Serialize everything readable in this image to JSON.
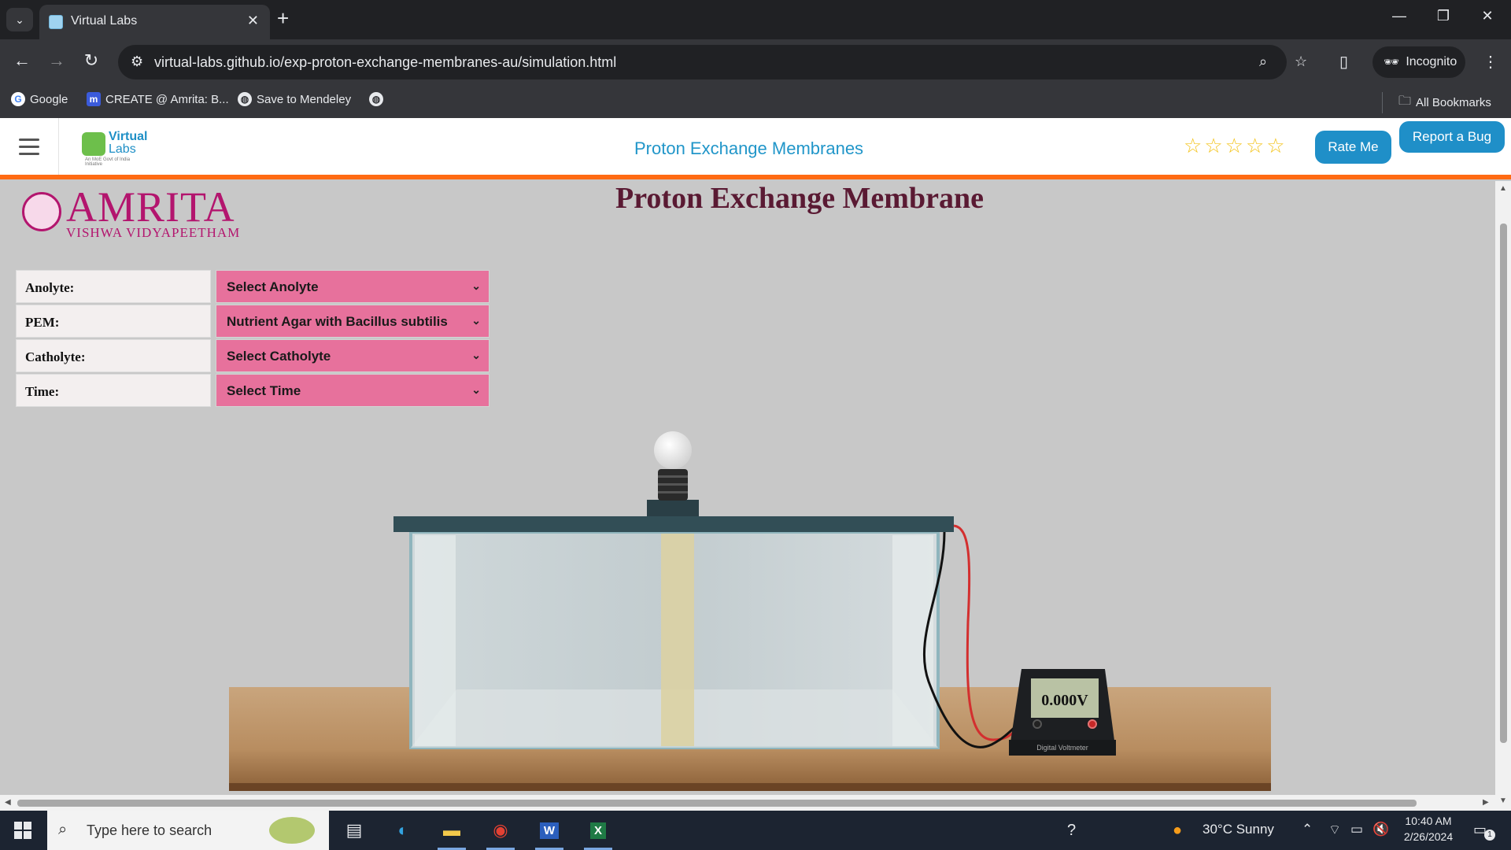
{
  "browser": {
    "tab_title": "Virtual Labs",
    "url": "virtual-labs.github.io/exp-proton-exchange-membranes-au/simulation.html",
    "incognito_label": "Incognito",
    "bookmarks": [
      {
        "label": "Google"
      },
      {
        "label": "CREATE @ Amrita: B..."
      },
      {
        "label": "Save to Mendeley"
      }
    ],
    "all_bookmarks_label": "All Bookmarks"
  },
  "header": {
    "logo_text_top": "Virtual",
    "logo_text_bottom": "Labs",
    "logo_subtitle": "An MoE Govt of India Initiative",
    "title": "Proton Exchange Membranes",
    "rating": 0,
    "rating_max": 5,
    "rate_button": "Rate Me",
    "bug_button": "Report a Bug"
  },
  "institution": {
    "name": "AMRITA",
    "subtitle": "VISHWA VIDYAPEETHAM"
  },
  "simulation": {
    "title": "Proton Exchange Membrane",
    "controls": [
      {
        "label": "Anolyte:",
        "value": "Select Anolyte"
      },
      {
        "label": "PEM:",
        "value": "Nutrient Agar with Bacillus subtilis"
      },
      {
        "label": "Catholyte:",
        "value": "Select Catholyte"
      },
      {
        "label": "Time:",
        "value": "Select Time"
      }
    ],
    "voltmeter_reading": "0.000V",
    "voltmeter_label": "Digital Voltmeter"
  },
  "taskbar": {
    "search_placeholder": "Type here to search",
    "weather": "30°C  Sunny",
    "time": "10:40 AM",
    "date": "2/26/2024",
    "notification_count": "1"
  },
  "colors": {
    "accent_blue": "#1f8fc8",
    "orange_bar": "#ff6a13",
    "amrita_magenta": "#b3156e",
    "select_pink": "#e7719c",
    "title_maroon": "#5a1a33"
  }
}
